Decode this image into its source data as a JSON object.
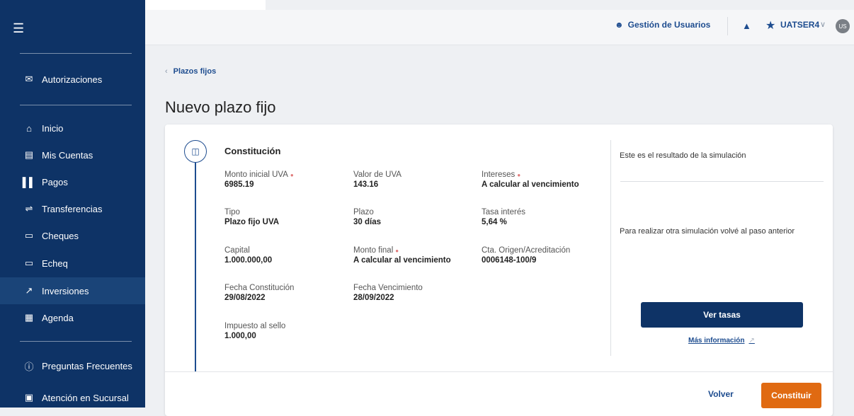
{
  "sidebar": {
    "menu_icon": "hamburger-icon",
    "items": [
      {
        "label": "Autorizaciones",
        "icon": "envelope-icon"
      },
      {
        "label": "Inicio",
        "icon": "home-icon"
      },
      {
        "label": "Mis Cuentas",
        "icon": "wallet-icon"
      },
      {
        "label": "Pagos",
        "icon": "barcode-icon"
      },
      {
        "label": "Transferencias",
        "icon": "transfer-arrows-icon"
      },
      {
        "label": "Cheques",
        "icon": "check-icon"
      },
      {
        "label": "Echeq",
        "icon": "echeq-icon"
      },
      {
        "label": "Inversiones",
        "icon": "trend-up-icon",
        "active": true
      },
      {
        "label": "Agenda",
        "icon": "contact-book-icon"
      },
      {
        "label": "Preguntas Frecuentes",
        "icon": "question-circle-icon"
      },
      {
        "label": "Atención en Sucursal",
        "icon": "monitor-icon"
      }
    ]
  },
  "topbar": {
    "users_label": "Gestión de Usuarios",
    "username": "UATSER4",
    "avatar_initials": "US"
  },
  "breadcrumb": {
    "label": "Plazos fijos"
  },
  "page_title": "Nuevo plazo fijo",
  "constitution": {
    "title": "Constitución",
    "fields": [
      {
        "label": "Monto inicial UVA",
        "value": "6985.19",
        "info": true
      },
      {
        "label": "Valor de UVA",
        "value": "143.16"
      },
      {
        "label": "Intereses",
        "value": "A calcular al vencimiento",
        "info": true
      },
      {
        "label": "Tipo",
        "value": "Plazo fijo UVA"
      },
      {
        "label": "Plazo",
        "value": "30 días"
      },
      {
        "label": "Tasa interés",
        "value": "5,64 %"
      },
      {
        "label": "Capital",
        "value": "1.000.000,00"
      },
      {
        "label": "Monto final",
        "value": "A calcular al vencimiento",
        "info": true
      },
      {
        "label": "Cta. Origen/Acreditación",
        "value": "0006148-100/9"
      },
      {
        "label": "Fecha Constitución",
        "value": "29/08/2022"
      },
      {
        "label": "Fecha Vencimiento",
        "value": "28/09/2022"
      },
      {
        "label": "Impuesto al sello",
        "value": "1.000,00"
      }
    ]
  },
  "simulation": {
    "result_text": "Este es el resultado de la simulación",
    "redo_text": "Para realizar otra simulación volvé al paso anterior",
    "rates_button": "Ver tasas",
    "more_info_link": "Más información"
  },
  "footer": {
    "back_button": "Volver",
    "submit_button": "Constituir"
  },
  "colors": {
    "sidebar_bg": "#0e3366",
    "primary": "#1d4c8f",
    "submit_bg": "#e06a12"
  }
}
